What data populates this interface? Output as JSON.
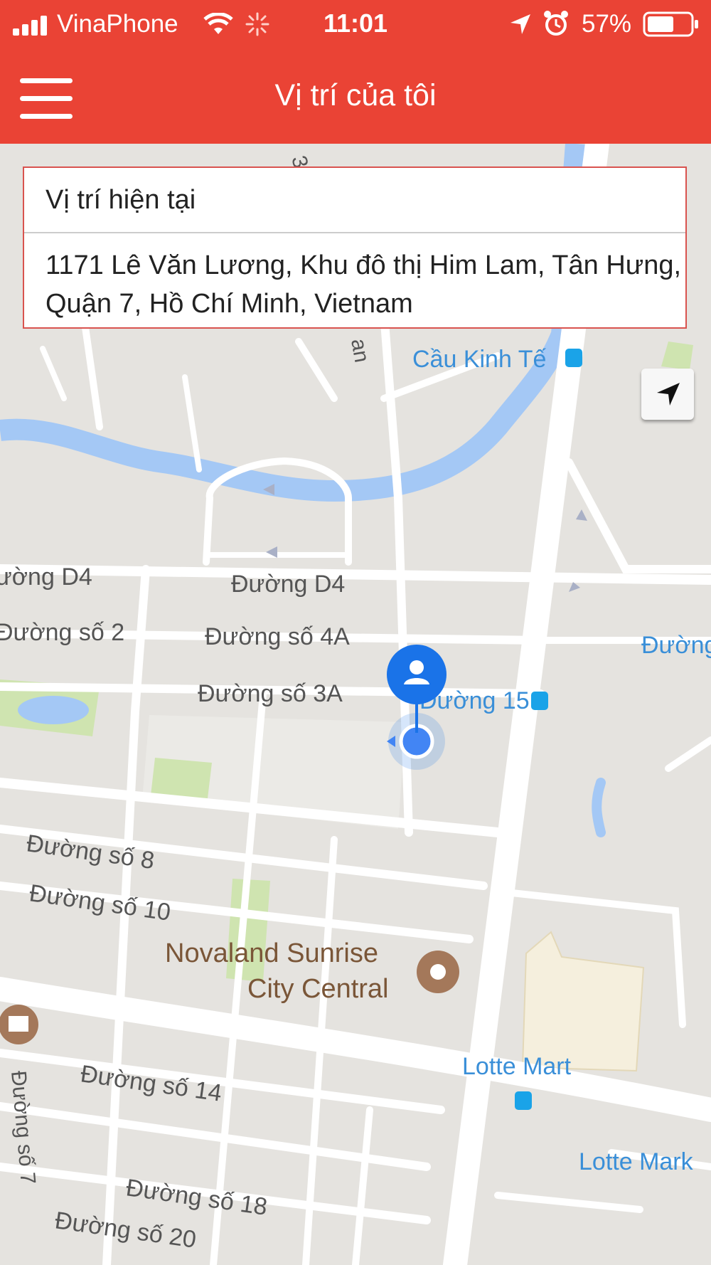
{
  "status_bar": {
    "carrier": "VinaPhone",
    "time": "11:01",
    "battery": "57%",
    "icons": [
      "signal-icon",
      "wifi-icon",
      "activity-spinner-icon",
      "location-arrow-icon",
      "alarm-icon",
      "battery-icon"
    ]
  },
  "nav": {
    "title": "Vị trí của tôi",
    "menu_icon": "hamburger-menu-icon"
  },
  "location_card": {
    "label": "Vị trí hiện tại",
    "address_line1": "1171 Lê Văn Lương, Khu đô thị Him Lam, Tân Hưng,",
    "address_line2": "Quận 7, Hồ Chí Minh, Vietnam"
  },
  "map": {
    "locate_button_icon": "navigation-arrow-icon",
    "user_pin_icon": "person-pin-icon",
    "labels": {
      "road_top": "3",
      "road_top2": "an",
      "cau_kinh_te": "Cầu Kinh Tế",
      "duong_d4_left": "ường D4",
      "duong_d4": "Đường D4",
      "duong_so_2": "Đường số 2",
      "duong_so_4a": "Đường số 4A",
      "duong_so_3a": "Đường số 3A",
      "duong_15": "Đường 15",
      "duong_right": "Đường",
      "duong_so_8": "Đường số 8",
      "duong_so_10": "Đường số 10",
      "novaland_1": "Novaland Sunrise",
      "novaland_2": "City Central",
      "lotte_mart": "Lotte Mart",
      "lotte_mark": "Lotte Mark",
      "duong_so_14": "Đường số 14",
      "duong_so_7": "Đường số 7",
      "duong_so_18": "Đường số 18",
      "duong_so_20": "Đường số 20"
    }
  },
  "colors": {
    "header_red": "#ea4335",
    "card_border": "#d9534f",
    "water": "#a4c8f5",
    "pin_blue": "#1a73e8",
    "transit_label": "#3a8fd8",
    "poi_label": "#7a5638"
  }
}
